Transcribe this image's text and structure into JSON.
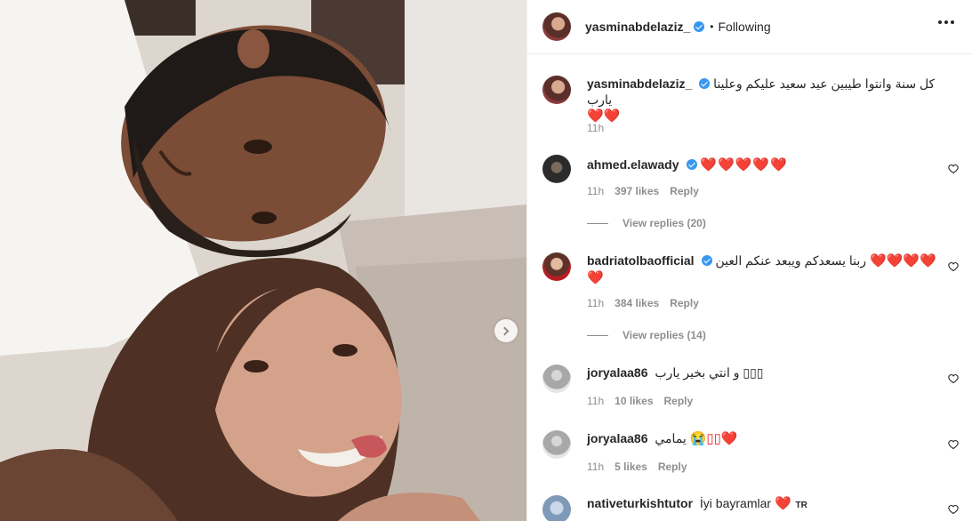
{
  "post": {
    "author": "yasminabdelaziz_",
    "follow_status": "Following",
    "dot": "•",
    "caption": "كل سنة وانتوا طيبين عيد سعيد عليكم وعلينا يارب",
    "caption_emoji": "❤️❤️",
    "time": "11h"
  },
  "comments": [
    {
      "user": "ahmed.elawady",
      "verified": true,
      "text": "",
      "emoji": "❤️❤️❤️❤️❤️",
      "time": "11h",
      "likes": "397 likes",
      "reply": "Reply",
      "view_replies": "View replies (20)"
    },
    {
      "user": "badriatolbaofficial",
      "verified": true,
      "text": "ربنا يسعدكم ويبعد عنكم العين",
      "emoji": "❤️❤️❤️❤️❤️",
      "time": "11h",
      "likes": "384 likes",
      "reply": "Reply",
      "view_replies": "View replies (14)"
    },
    {
      "user": "joryalaa86",
      "verified": false,
      "text": "و انتي بخير يارب",
      "emoji": "▯▯▯",
      "time": "11h",
      "likes": "10 likes",
      "reply": "Reply"
    },
    {
      "user": "joryalaa86",
      "verified": false,
      "text": "يمامي",
      "emoji": "😭▯▯❤️",
      "time": "11h",
      "likes": "5 likes",
      "reply": "Reply"
    },
    {
      "user": "nativeturkishtutor",
      "verified": false,
      "text": "İyi bayramlar",
      "emoji": "❤️",
      "flag": "TR"
    }
  ],
  "colors": {
    "link_blue": "#3897f0",
    "meta_gray": "#8e8e8e",
    "heart_red": "#ed1c24"
  }
}
